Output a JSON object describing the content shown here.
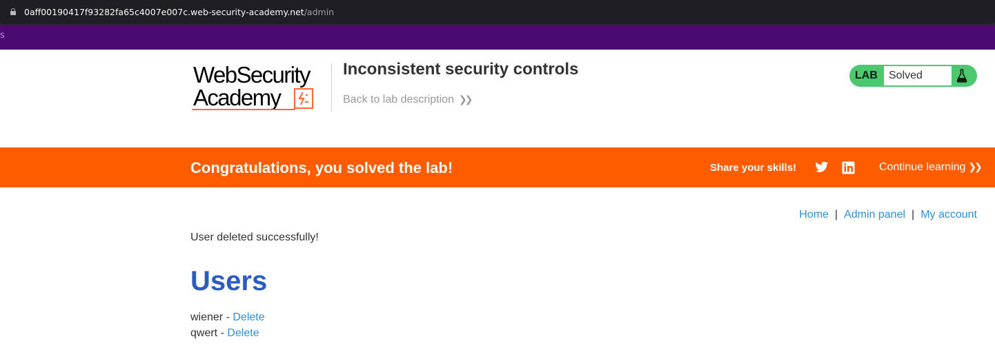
{
  "browser": {
    "url_host": "0aff00190417f93282fa65c4007e007c.web-security-academy.net",
    "url_path": "/admin",
    "strip_glyph": "s"
  },
  "header": {
    "logo_line1": "WebSecurity",
    "logo_line2": "Academy",
    "lab_title": "Inconsistent security controls",
    "back_link": "Back to lab description",
    "lab_label": "LAB",
    "lab_status": "Solved"
  },
  "banner": {
    "message": "Congratulations, you solved the lab!",
    "share_label": "Share your skills!",
    "continue_label": "Continue learning"
  },
  "nav": {
    "home": "Home",
    "separator": "|",
    "admin_panel": "Admin panel",
    "my_account": "My account"
  },
  "main": {
    "status_message": "User deleted successfully!",
    "heading": "Users",
    "users": [
      {
        "name": "wiener",
        "separator": " - ",
        "action": "Delete"
      },
      {
        "name": "qwert",
        "separator": " - ",
        "action": "Delete"
      }
    ]
  },
  "colors": {
    "banner": "#ff5c00",
    "badge": "#4cc96f",
    "link": "#2e8fd6",
    "heading": "#2a5cc2",
    "purple_strip": "#4a0a72"
  },
  "icons": [
    "lock-icon",
    "twitter-icon",
    "linkedin-icon",
    "flask-icon",
    "chevron-right-icon",
    "logo-lightning-icon"
  ]
}
